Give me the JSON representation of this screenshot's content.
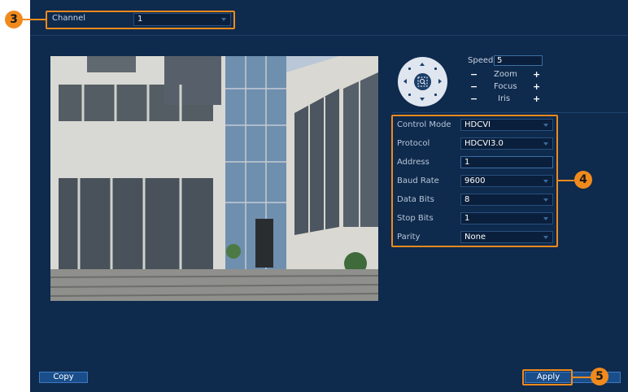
{
  "channel": {
    "label": "Channel",
    "value": "1"
  },
  "ptz": {
    "speed_label": "Speed",
    "speed_value": "5",
    "zoom_label": "Zoom",
    "focus_label": "Focus",
    "iris_label": "Iris",
    "minus": "−",
    "plus": "+"
  },
  "settings": [
    {
      "label": "Control Mode",
      "value": "HDCVI",
      "kind": "select"
    },
    {
      "label": "Protocol",
      "value": "HDCVI3.0",
      "kind": "select"
    },
    {
      "label": "Address",
      "value": "1",
      "kind": "input"
    },
    {
      "label": "Baud Rate",
      "value": "9600",
      "kind": "select"
    },
    {
      "label": "Data Bits",
      "value": "8",
      "kind": "select"
    },
    {
      "label": "Stop Bits",
      "value": "1",
      "kind": "select"
    },
    {
      "label": "Parity",
      "value": "None",
      "kind": "select"
    }
  ],
  "buttons": {
    "copy": "Copy",
    "apply": "Apply"
  },
  "callouts": {
    "channel": "3",
    "settings": "4",
    "apply": "5"
  },
  "colors": {
    "panel": "#0e2a4d",
    "accent": "#f08a1c",
    "button": "#1a4e8a"
  }
}
